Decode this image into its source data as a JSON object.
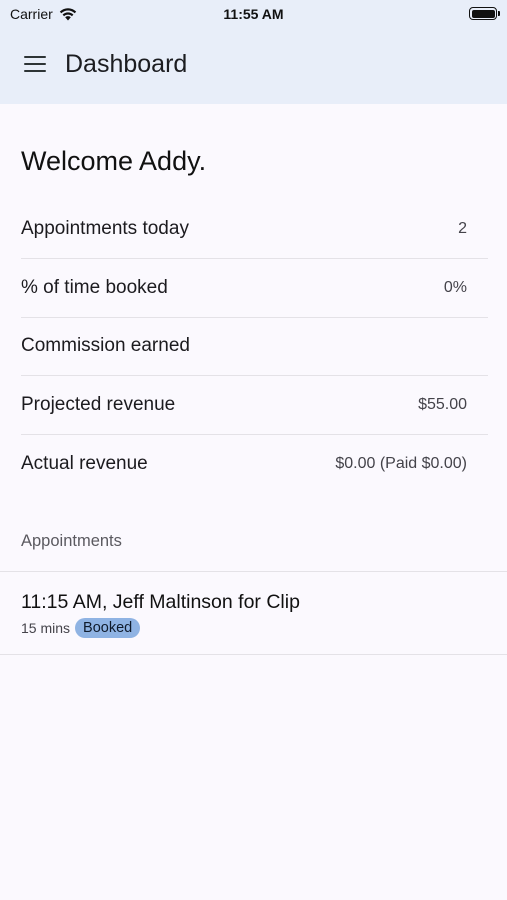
{
  "status_bar": {
    "carrier": "Carrier",
    "time": "11:55 AM"
  },
  "app_bar": {
    "title": "Dashboard"
  },
  "welcome": "Welcome Addy.",
  "stats": [
    {
      "label": "Appointments today",
      "value": "2"
    },
    {
      "label": "% of time booked",
      "value": "0%"
    },
    {
      "label": "Commission earned",
      "value": ""
    },
    {
      "label": "Projected revenue",
      "value": "$55.00"
    },
    {
      "label": "Actual revenue",
      "value": "$0.00 (Paid $0.00)"
    }
  ],
  "appointments_section": {
    "header": "Appointments",
    "items": [
      {
        "title": "11:15 AM, Jeff Maltinson for Clip",
        "duration": "15 mins",
        "status": "Booked"
      }
    ]
  },
  "colors": {
    "app_bar_bg": "#e8eef9",
    "page_bg": "#fbf9fe",
    "badge_bg": "#8fb3e3"
  }
}
